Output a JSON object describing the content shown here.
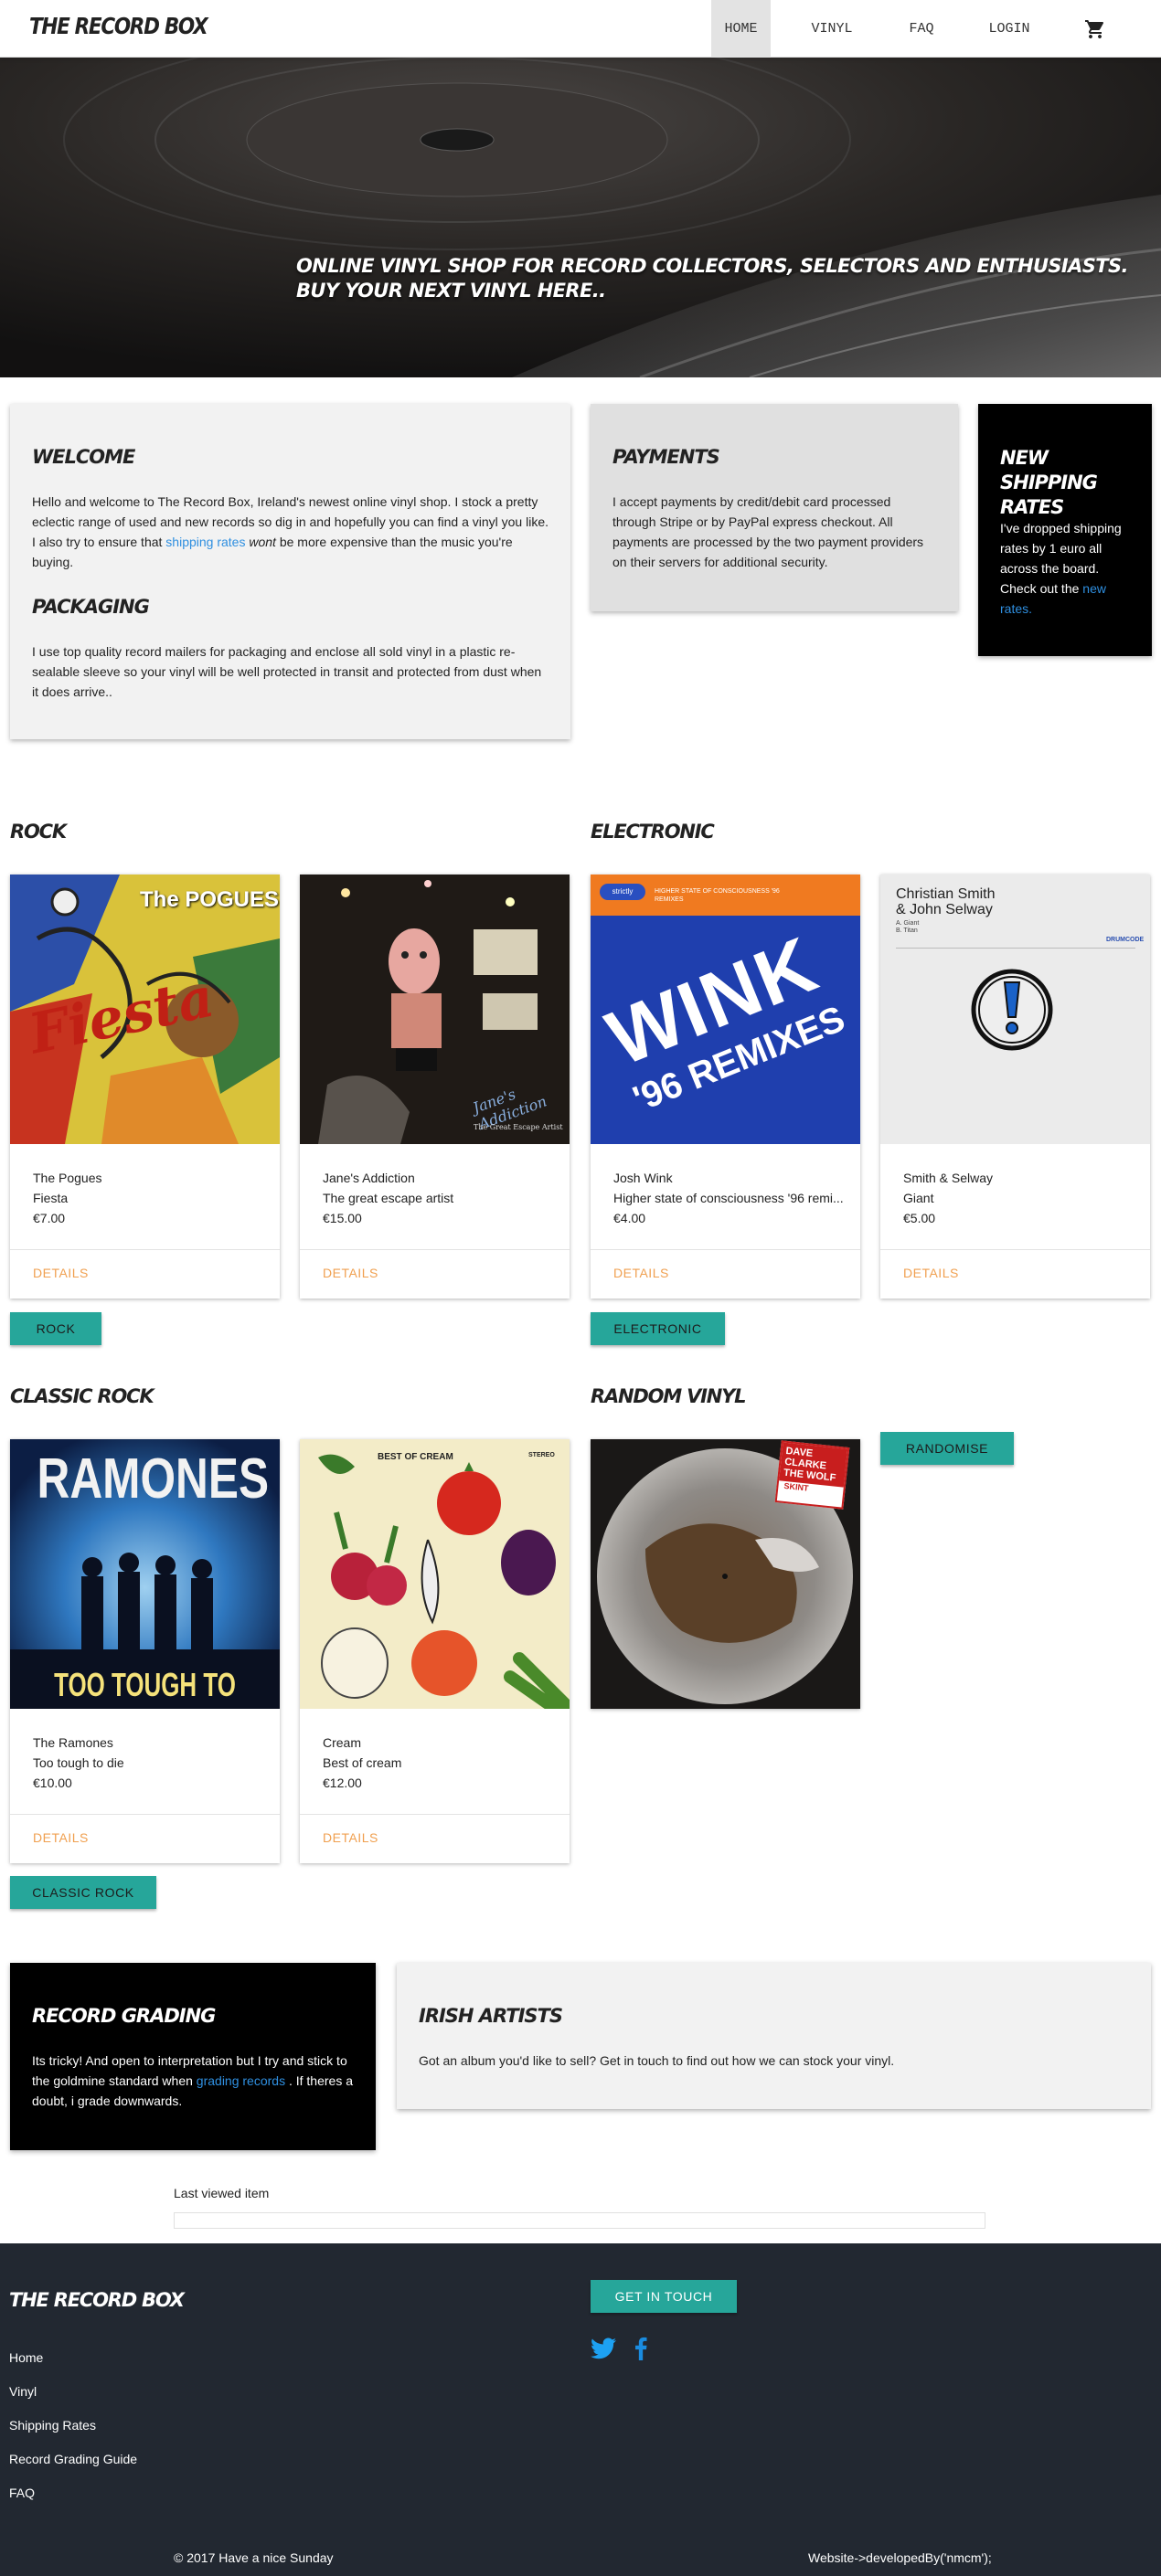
{
  "nav": {
    "brand": "THE RECORD BOX",
    "links": [
      "HOME",
      "VINYL",
      "FAQ",
      "LOGIN"
    ],
    "cart_icon": "shopping-cart-icon"
  },
  "hero": {
    "line1": "ONLINE VINYL SHOP FOR RECORD COLLECTORS, SELECTORS AND ENTHUSIASTS.",
    "line2": "BUY YOUR NEXT VINYL HERE.."
  },
  "welcome": {
    "title": "WELCOME",
    "text_before": "Hello and welcome to The Record Box, Ireland's newest online vinyl shop. I stock a pretty eclectic range of used and new records so dig in and hopefully you can find a vinyl you like. I also try to ensure that ",
    "link": "shipping rates",
    "emphasis": "wont",
    "text_after": " be more expensive than the music you're buying.",
    "packaging_title": "PACKAGING",
    "packaging_text": "I use top quality record mailers for packaging and enclose all sold vinyl in a plastic re-sealable sleeve so your vinyl will be well protected in transit and protected from dust when it does arrive.."
  },
  "payments": {
    "title": "PAYMENTS",
    "text": "I accept payments by credit/debit card processed through Stripe or by PayPal express checkout. All payments are processed by the two payment providers on their servers for additional security."
  },
  "shipping": {
    "title": "NEW SHIPPING RATES",
    "text": "I've dropped shipping rates by 1 euro all across the board. Check out the ",
    "link": "new rates."
  },
  "sections": {
    "rock": "ROCK",
    "electronic": "ELECTRONIC",
    "classic_rock": "CLASSIC ROCK",
    "random": "RANDOM VINYL"
  },
  "products": {
    "rock": [
      {
        "artist": "The Pogues",
        "title": "Fiesta",
        "price": "€7.00",
        "details": "DETAILS"
      },
      {
        "artist": "Jane's Addiction",
        "title": "The great escape artist",
        "price": "€15.00",
        "details": "DETAILS"
      }
    ],
    "electronic": [
      {
        "artist": "Josh Wink",
        "title": "Higher state of consciousness '96 remi...",
        "price": "€4.00",
        "details": "DETAILS"
      },
      {
        "artist": "Smith & Selway",
        "title": "Giant",
        "price": "€5.00",
        "details": "DETAILS"
      }
    ],
    "classic_rock": [
      {
        "artist": "The Ramones",
        "title": "Too tough to die",
        "price": "€10.00",
        "details": "DETAILS"
      },
      {
        "artist": "Cream",
        "title": "Best of cream",
        "price": "€12.00",
        "details": "DETAILS"
      }
    ]
  },
  "covers": {
    "pogues_band": "The POGUES",
    "pogues_title": "Fiesta",
    "janes_band": "Jane's Addiction",
    "janes_sub": "The Great Escape Artist",
    "wink_label": "strictly",
    "wink_small": "HIGHER STATE OF CONSCIOUSNESS '96 REMIXES",
    "wink_main": "WINK",
    "wink_sub": "'96 REMIXES",
    "smith_artist1": "Christian Smith",
    "smith_artist2": "& John Selway",
    "smith_track1": "A. Giant",
    "smith_track2": "B. Titan",
    "smith_label": "DRUMCODE",
    "ramones_band": "RAMONES",
    "ramones_title": "TOO TOUGH TO DIE",
    "cream_title": "BEST OF CREAM",
    "cream_stereo": "STEREO",
    "random_line1": "DAVE",
    "random_line2": "CLARKE",
    "random_line3": "THE WOLF",
    "random_label": "SKINT"
  },
  "buttons": {
    "rock": "ROCK",
    "electronic": "ELECTRONIC",
    "classic_rock": "CLASSIC ROCK",
    "randomise": "RANDOMISE",
    "get_in_touch": "GET IN TOUCH"
  },
  "grading": {
    "title": "RECORD GRADING",
    "text_before": "Its tricky! And open to interpretation but I try and stick to the goldmine standard when ",
    "link": "grading records",
    "text_after": " . If theres a doubt, i grade downwards."
  },
  "irish": {
    "title": "IRISH ARTISTS",
    "text": "Got an album you'd like to sell? Get in touch to find out how we can stock your vinyl."
  },
  "last_viewed": {
    "label": "Last viewed item"
  },
  "footer": {
    "brand": "THE RECORD BOX",
    "links": [
      "Home",
      "Vinyl",
      "Shipping Rates",
      "Record Grading Guide",
      "FAQ"
    ],
    "copyright": "© 2017 Have a nice Sunday",
    "developer": "Website->developedBy('nmcm');",
    "social": [
      "twitter-icon",
      "facebook-icon"
    ]
  },
  "colors": {
    "accent": "#26a69a",
    "link": "#2f8fe0",
    "details": "#f0a050",
    "footer_bg": "#222831"
  }
}
